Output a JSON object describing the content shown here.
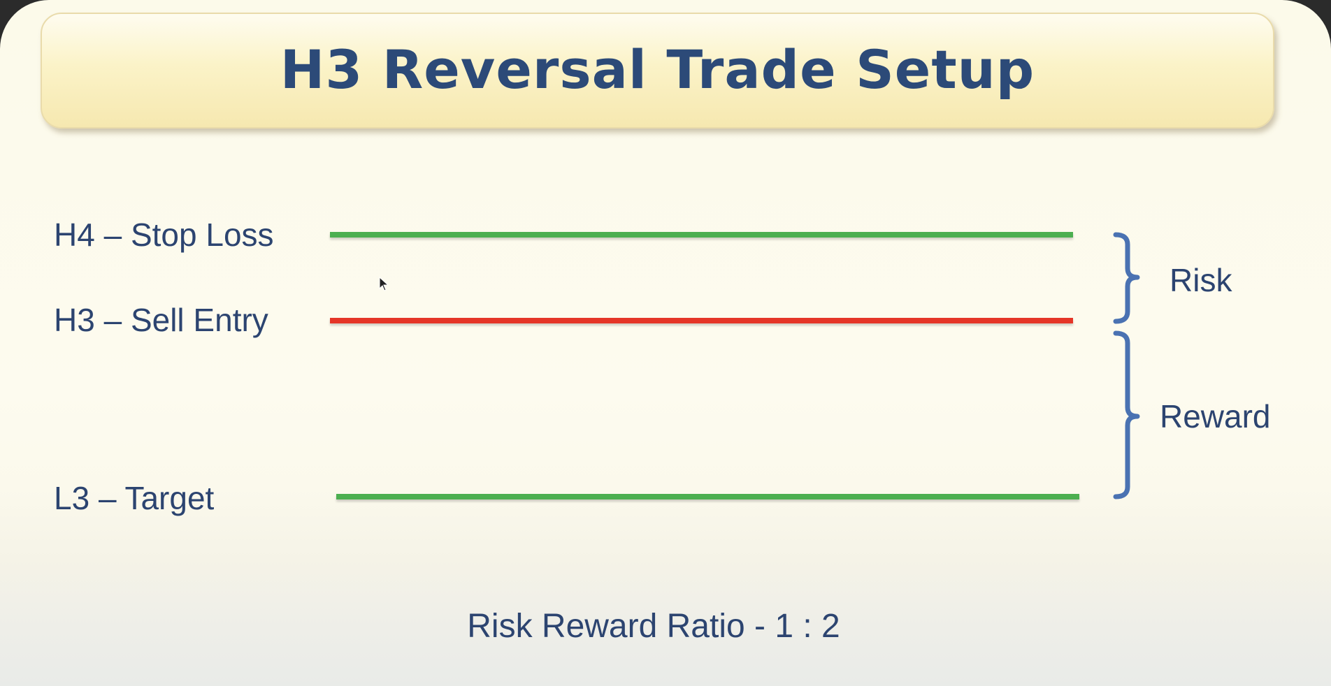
{
  "title": "H3 Reversal Trade Setup",
  "levels": [
    {
      "label": "H4 – Stop Loss",
      "color": "#4caf50"
    },
    {
      "label": "H3 – Sell Entry",
      "color": "#e53527"
    },
    {
      "label": "L3 – Target",
      "color": "#4caf50"
    }
  ],
  "brackets": {
    "risk": "Risk",
    "reward": "Reward",
    "color": "#4a72b2"
  },
  "ratio_text": "Risk Reward Ratio - 1 : 2"
}
